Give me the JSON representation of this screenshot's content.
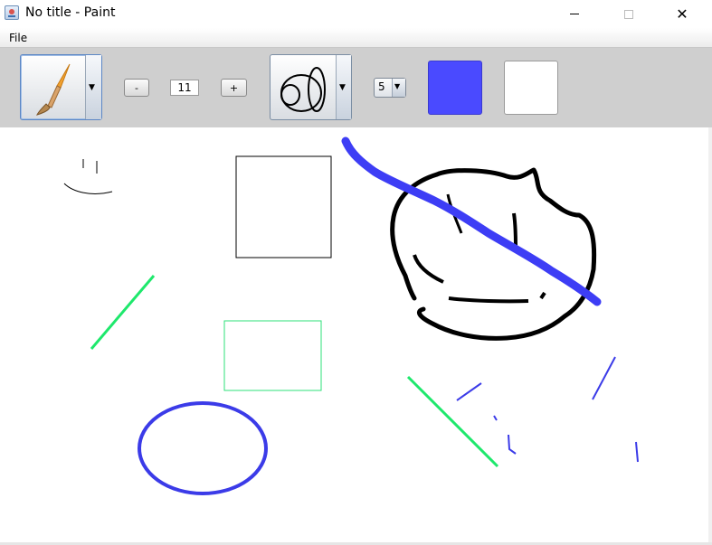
{
  "window": {
    "title": "No title - Paint",
    "minimize_icon": "minimize-icon",
    "maximize_icon": "maximize-icon",
    "close_icon": "close-icon",
    "close_glyph": "✕"
  },
  "menu": {
    "file_label": "File"
  },
  "toolbar": {
    "tool_selector_icon": "paintbrush-icon",
    "dropdown_glyph": "▼",
    "decrement_label": "-",
    "brush_size": "11",
    "increment_label": "+",
    "shape_selector_icon": "shapes-icon",
    "stroke_width": "5",
    "primary_color": "#4a4aff",
    "secondary_color": "#ffffff"
  }
}
